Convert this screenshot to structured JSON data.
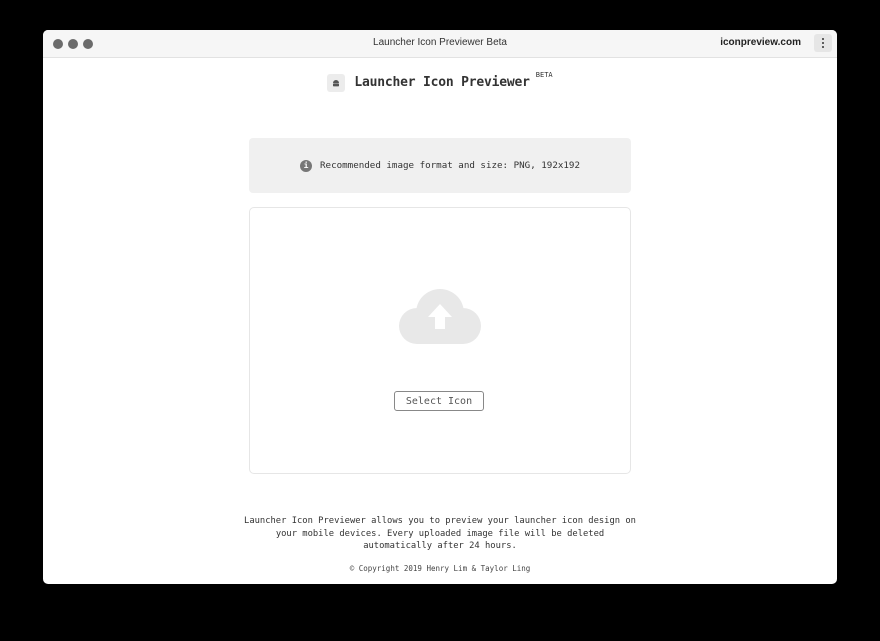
{
  "window": {
    "title": "Launcher Icon Previewer Beta",
    "domain": "iconpreview.com"
  },
  "header": {
    "app_name": "Launcher Icon Previewer",
    "badge": "BETA",
    "logo_icon": "android-icon"
  },
  "notice": {
    "icon": "info-icon",
    "text": "Recommended image format and size: PNG, 192x192"
  },
  "upload": {
    "icon": "cloud-upload-icon",
    "button_label": "Select Icon"
  },
  "footer": {
    "description": "Launcher Icon Previewer allows you to preview your launcher icon design on your mobile devices. Every uploaded image file will be deleted automatically after 24 hours.",
    "copyright": "© Copyright 2019 Henry Lim & Taylor Ling"
  },
  "colors": {
    "background": "#000000",
    "surface": "#ffffff",
    "notice_bg": "#f0f0f0",
    "cloud": "#e8e8e8",
    "text": "#333333"
  }
}
